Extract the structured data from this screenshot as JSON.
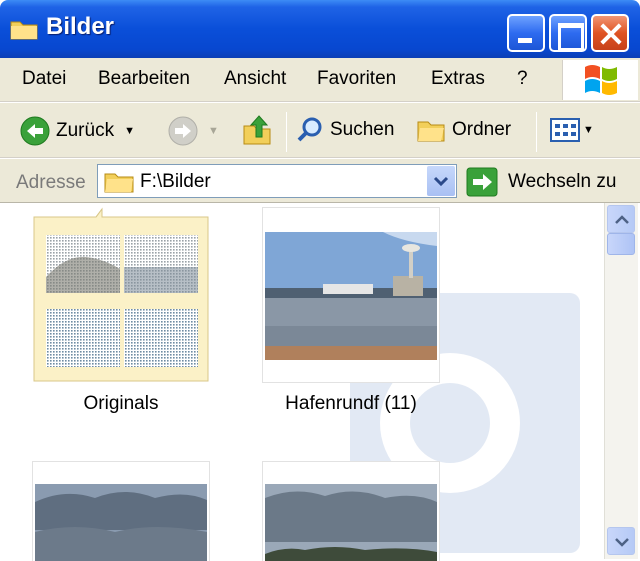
{
  "window": {
    "title": "Bilder"
  },
  "menu": [
    "Datei",
    "Bearbeiten",
    "Ansicht",
    "Favoriten",
    "Extras",
    "?"
  ],
  "toolbar": {
    "back_label": "Zurück",
    "search_label": "Suchen",
    "folders_label": "Ordner"
  },
  "address": {
    "label": "Adresse",
    "value": "F:\\Bilder",
    "go_label": "Wechseln zu"
  },
  "items": [
    {
      "name": "Originals",
      "type": "folder",
      "icon": "folder-thumbnail-icon"
    },
    {
      "name": "Hafenrundf (11)",
      "type": "image",
      "icon": "harbor-photo"
    },
    {
      "name": "",
      "type": "image",
      "icon": "cloudy-sky-photo"
    },
    {
      "name": "",
      "type": "image",
      "icon": "cloudy-coast-photo"
    }
  ],
  "colors": {
    "title_bar": "#0a4fd9",
    "chrome": "#ece9d8",
    "close_button": "#df5424"
  }
}
